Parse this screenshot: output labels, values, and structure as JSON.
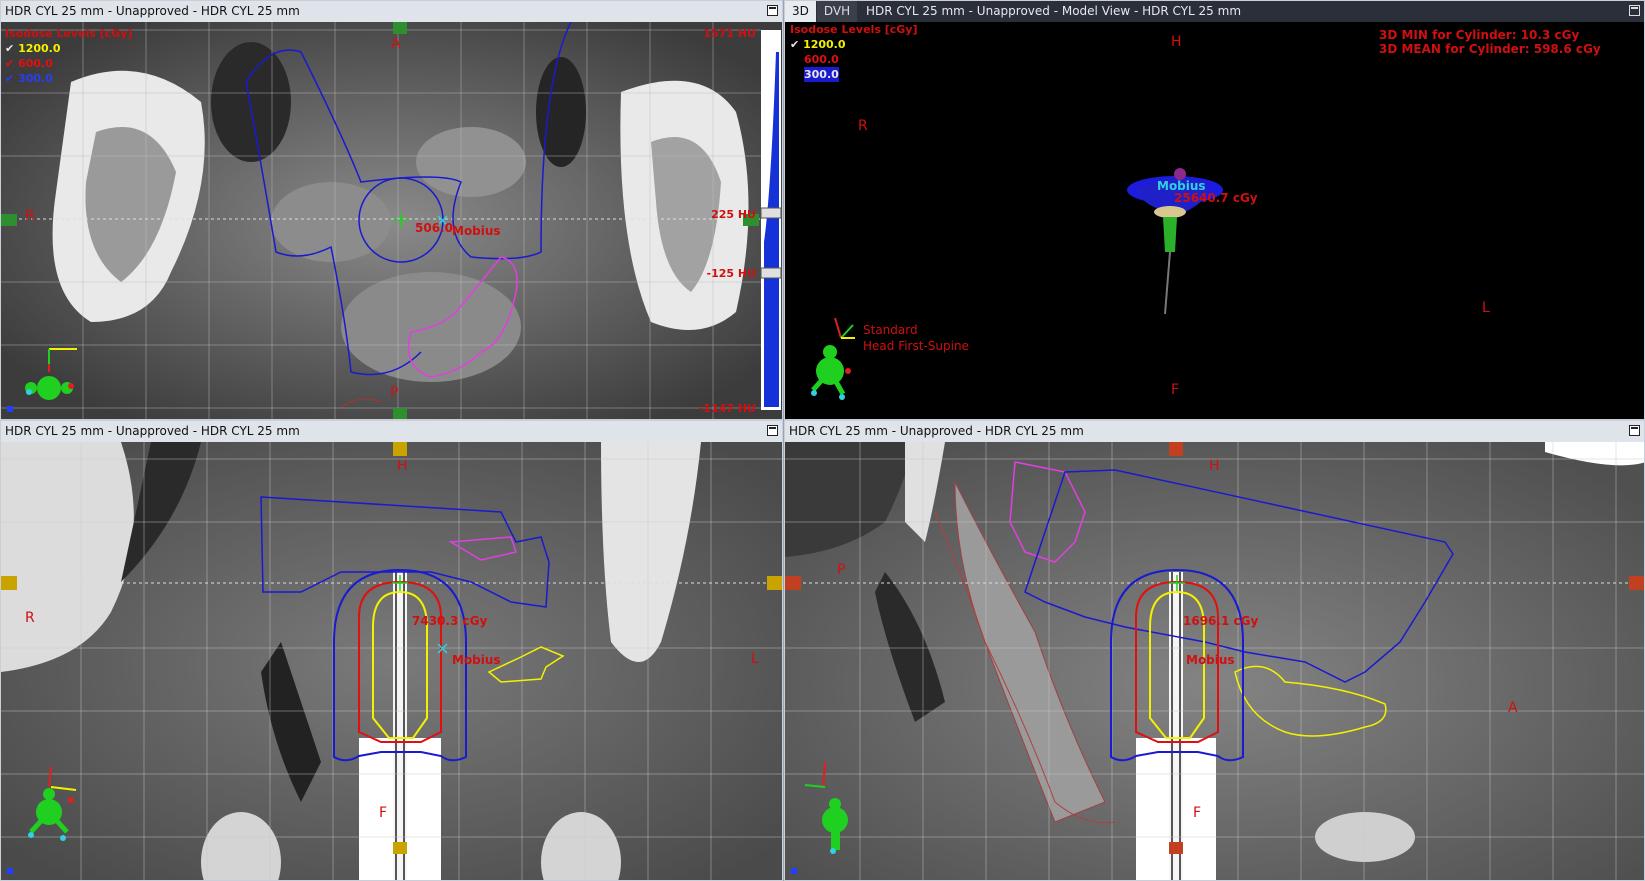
{
  "panes": {
    "axial": {
      "title": "HDR CYL 25 mm  -  Unapproved - HDR CYL 25 mm",
      "legend_title": "Isodose Levels [cGy]",
      "levels": [
        {
          "check": "✔",
          "value": "1200.0",
          "color": "#f2f200"
        },
        {
          "check": "✔",
          "value": "600.0",
          "color": "#e01010"
        },
        {
          "check": "✔",
          "value": "300.0",
          "color": "#2b3df0"
        }
      ],
      "orient_top": "A",
      "orient_bottom": "P",
      "orient_left": "R",
      "hu_top": "1571 HU",
      "hu_window_high": "225 HU",
      "hu_window_low": "-125 HU",
      "hu_bottom": "-1147 HU",
      "dose_value": "506.0",
      "point_name": "Mobius"
    },
    "model": {
      "tabs": [
        "3D",
        "DVH"
      ],
      "title": "HDR CYL 25 mm - Unapproved - Model View - HDR CYL 25 mm",
      "legend_title": "Isodose Levels [cGy]",
      "levels": [
        {
          "check": "✔",
          "value": "1200.0",
          "color": "#f2f200"
        },
        {
          "check": "",
          "value": "600.0",
          "color": "#e01010"
        },
        {
          "check": "",
          "value": "300.0",
          "color": "#2b3df0"
        }
      ],
      "stat_min": "3D MIN for Cylinder: 10.3 cGy",
      "stat_mean": "3D MEAN for Cylinder: 598.6 cGy",
      "orient_top": "H",
      "orient_bottom": "F",
      "orient_left": "R",
      "orient_right": "L",
      "point_name": "Mobius",
      "dose_value": "25640.7 cGy",
      "view_name": "Standard",
      "patient_position": "Head First-Supine"
    },
    "coronal": {
      "title": "HDR CYL 25 mm  -  Unapproved - HDR CYL 25 mm",
      "orient_top": "H",
      "orient_bottom": "F",
      "orient_left": "R",
      "orient_right": "L",
      "dose_value": "7430.3 cGy",
      "point_name": "Mobius"
    },
    "sagittal": {
      "title": "HDR CYL 25 mm  -  Unapproved - HDR CYL 25 mm",
      "orient_top": "H",
      "orient_bottom": "F",
      "orient_left": "P",
      "orient_right": "A",
      "dose_value": "1696.1 cGy",
      "point_name": "Mobius"
    }
  },
  "colors": {
    "label_red": "#d01010",
    "isodose_1200": "#f2f200",
    "isodose_600": "#e01010",
    "isodose_300": "#2b3df0",
    "structure_magenta": "#e040e0",
    "structure_blue": "#1a1ad0",
    "point_cyan": "#30d0e0",
    "ui_panel": "#dfe3ea"
  },
  "icons": [
    "orientation-figure-icon",
    "maximize-icon",
    "axis-triad-icon",
    "window-arrow-up-icon",
    "window-arrow-down-icon"
  ]
}
